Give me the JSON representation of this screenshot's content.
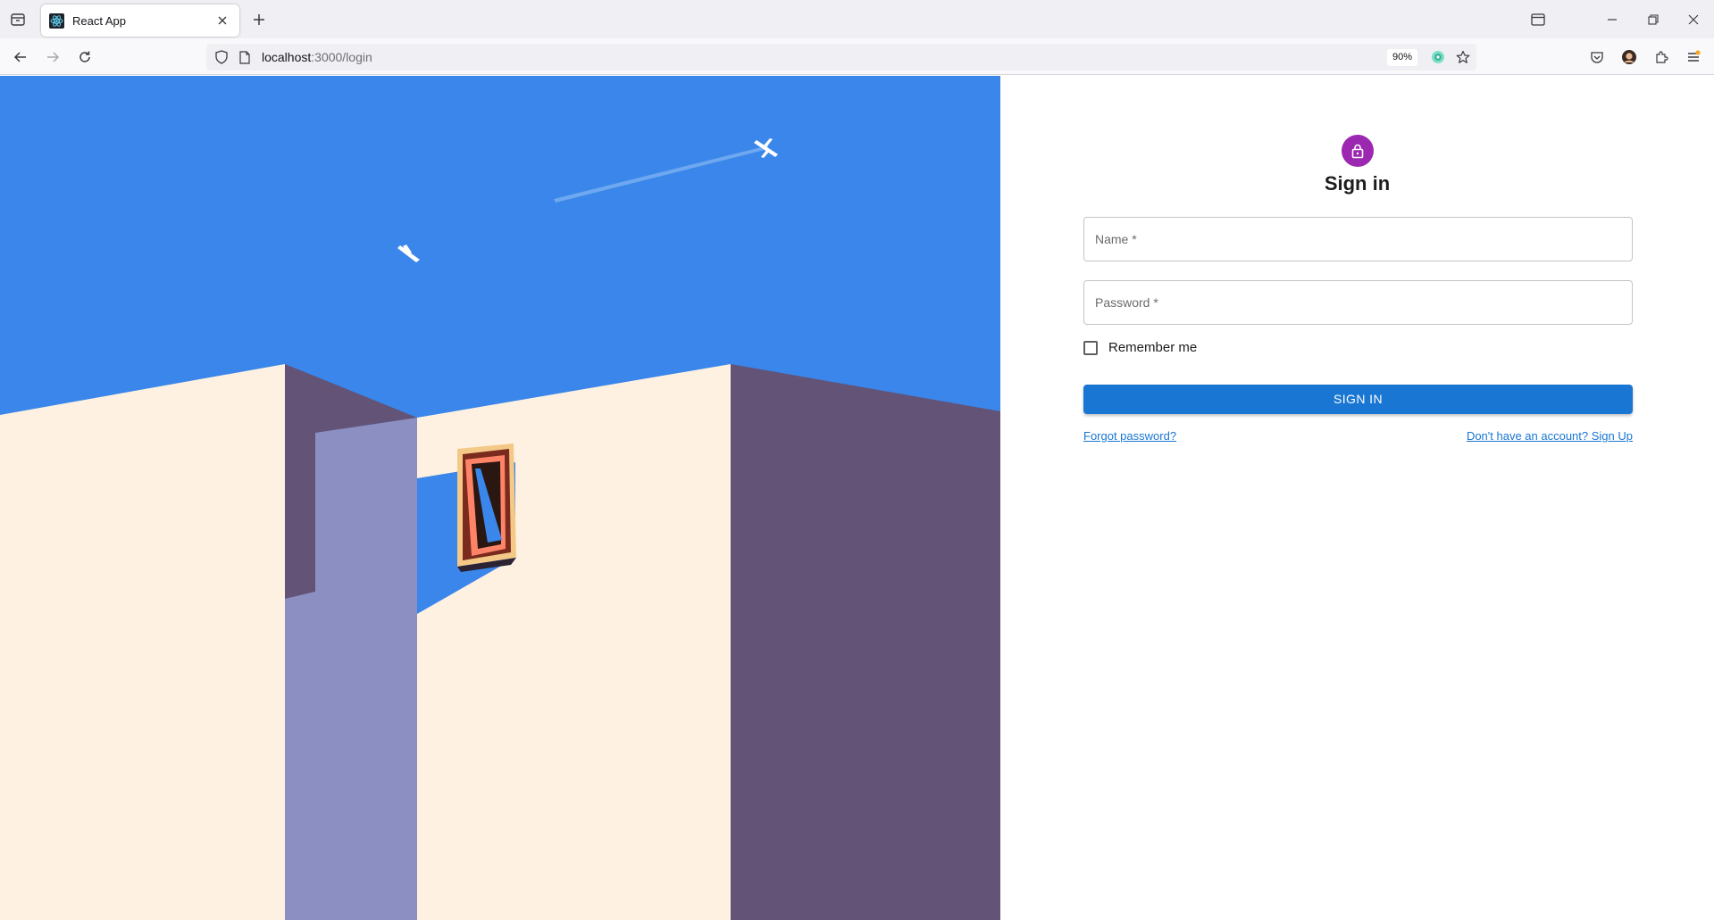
{
  "browser": {
    "tab_title": "React App",
    "url_host": "localhost",
    "url_path": ":3000/login",
    "zoom": "90%",
    "icons": {
      "tab_list": "tab-list-icon",
      "favicon": "react-icon",
      "close_tab": "close-icon",
      "new_tab": "plus-icon",
      "back": "back-arrow-icon",
      "forward": "forward-arrow-icon",
      "reload": "reload-icon",
      "tracking": "shield-icon",
      "page": "page-icon",
      "extension": "extension-badge-icon",
      "bookmark": "star-icon",
      "pocket": "pocket-icon",
      "account": "profile-avatar-icon",
      "extensions": "puzzle-icon",
      "menu": "hamburger-menu-icon",
      "minimize": "minimize-icon",
      "restore": "restore-icon",
      "close_window": "close-icon"
    }
  },
  "login": {
    "title": "Sign in",
    "avatar_icon": "lock-icon",
    "name_placeholder": "Name *",
    "password_placeholder": "Password *",
    "remember_label": "Remember me",
    "submit_label": "SIGN IN",
    "forgot_link": "Forgot password?",
    "signup_link": "Don't have an account? Sign Up"
  },
  "colors": {
    "sky": "#3a86ea",
    "wall": "#fef1e1",
    "shadow_wall": "#625377",
    "shadow_cast": "#8b8fc1",
    "primary": "#1976d2",
    "avatar": "#9c27b0"
  }
}
